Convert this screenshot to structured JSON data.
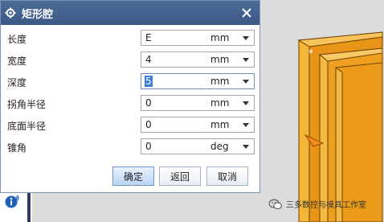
{
  "dialog": {
    "title": "矩形腔",
    "rows": [
      {
        "label": "长度",
        "value": "E",
        "unit": "mm"
      },
      {
        "label": "宽度",
        "value": "4",
        "unit": "mm"
      },
      {
        "label": "深度",
        "value": "5",
        "unit": "mm"
      },
      {
        "label": "拐角半径",
        "value": "0",
        "unit": "mm"
      },
      {
        "label": "底面半径",
        "value": "0",
        "unit": "mm"
      },
      {
        "label": "锥角",
        "value": "0",
        "unit": "deg"
      }
    ],
    "buttons": {
      "ok": "确定",
      "back": "返回",
      "cancel": "取消"
    }
  },
  "watermark": {
    "text": "三多数控与模具工作室"
  },
  "colors": {
    "title_bar": "#4d6b97",
    "solid_face": "#f0a11c",
    "solid_edge": "#8a5a00",
    "selection": "#3e7fd6"
  },
  "icons": [
    "gear-icon",
    "close-icon",
    "chevron-down-icon",
    "info-icon",
    "wechat-icon"
  ]
}
